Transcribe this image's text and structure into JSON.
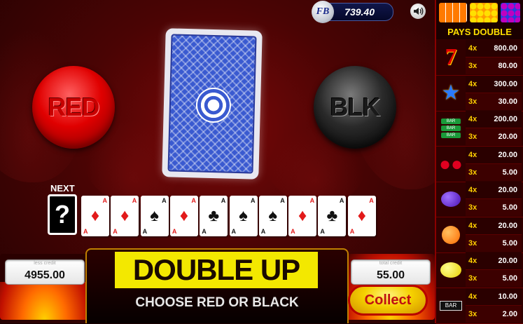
{
  "balance": {
    "logo": "FB",
    "amount": "739.40"
  },
  "sound_icon": "speaker-icon",
  "buttons": {
    "red": "RED",
    "black": "BLK",
    "collect": "Collect"
  },
  "history": {
    "next_label": "NEXT",
    "next_symbol": "?",
    "cards": [
      {
        "rank": "A",
        "suit": "♦",
        "color": "red"
      },
      {
        "rank": "A",
        "suit": "♦",
        "color": "red"
      },
      {
        "rank": "A",
        "suit": "♠",
        "color": "black"
      },
      {
        "rank": "A",
        "suit": "♦",
        "color": "red"
      },
      {
        "rank": "A",
        "suit": "♣",
        "color": "black"
      },
      {
        "rank": "A",
        "suit": "♠",
        "color": "black"
      },
      {
        "rank": "A",
        "suit": "♠",
        "color": "black"
      },
      {
        "rank": "A",
        "suit": "♦",
        "color": "red"
      },
      {
        "rank": "A",
        "suit": "♣",
        "color": "black"
      },
      {
        "rank": "A",
        "suit": "♦",
        "color": "red"
      }
    ]
  },
  "bottom": {
    "win_label": "less credit",
    "win_value": "4955.00",
    "bet_label": "total credit",
    "bet_value": "55.00",
    "title": "DOUBLE UP",
    "instruction": "CHOOSE RED OR BLACK"
  },
  "paytable": {
    "header": "PAYS DOUBLE",
    "rows": [
      {
        "symbol": "seven-icon",
        "lines": [
          {
            "mult": "4x",
            "pay": "800.00"
          },
          {
            "mult": "3x",
            "pay": "80.00"
          }
        ]
      },
      {
        "symbol": "star-icon",
        "lines": [
          {
            "mult": "4x",
            "pay": "300.00"
          },
          {
            "mult": "3x",
            "pay": "30.00"
          }
        ]
      },
      {
        "symbol": "triple-bar-icon",
        "lines": [
          {
            "mult": "4x",
            "pay": "200.00"
          },
          {
            "mult": "3x",
            "pay": "20.00"
          }
        ]
      },
      {
        "symbol": "cherry-icon",
        "lines": [
          {
            "mult": "4x",
            "pay": "20.00"
          },
          {
            "mult": "3x",
            "pay": "5.00"
          }
        ]
      },
      {
        "symbol": "plum-icon",
        "lines": [
          {
            "mult": "4x",
            "pay": "20.00"
          },
          {
            "mult": "3x",
            "pay": "5.00"
          }
        ]
      },
      {
        "symbol": "orange-icon",
        "lines": [
          {
            "mult": "4x",
            "pay": "20.00"
          },
          {
            "mult": "3x",
            "pay": "5.00"
          }
        ]
      },
      {
        "symbol": "lemon-icon",
        "lines": [
          {
            "mult": "4x",
            "pay": "20.00"
          },
          {
            "mult": "3x",
            "pay": "5.00"
          }
        ]
      },
      {
        "symbol": "bar-icon",
        "lines": [
          {
            "mult": "4x",
            "pay": "10.00"
          },
          {
            "mult": "3x",
            "pay": "2.00"
          }
        ]
      }
    ]
  }
}
